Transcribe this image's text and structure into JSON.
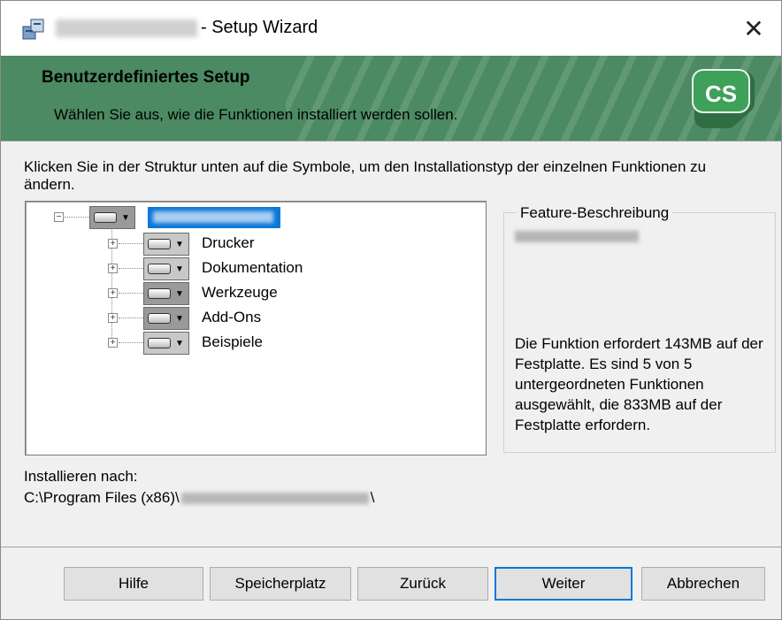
{
  "window": {
    "title": "- Setup Wizard",
    "close_glyph": "✕"
  },
  "banner": {
    "heading": "Benutzerdefiniertes Setup",
    "subtitle": "Wählen Sie aus, wie die Funktionen installiert werden sollen.",
    "logo_text": "CS",
    "logo_color": "#3fa05a",
    "background_color": "#4b8a62"
  },
  "instructions": "Klicken Sie in der Struktur unten auf die Symbole, um den Installationstyp der einzelnen Funktionen zu ändern.",
  "tree": {
    "root": {
      "expander": "−",
      "selected": true
    },
    "items": [
      {
        "label": "Drucker",
        "expander": "+"
      },
      {
        "label": "Dokumentation",
        "expander": "+"
      },
      {
        "label": "Werkzeuge",
        "expander": "+"
      },
      {
        "label": "Add-Ons",
        "expander": "+"
      },
      {
        "label": "Beispiele",
        "expander": "+"
      }
    ]
  },
  "feature": {
    "legend": "Feature-Beschreibung",
    "text": "Die Funktion erfordert 143MB auf der Festplatte. Es sind 5 von 5 untergeordneten Funktionen ausgewählt, die 833MB auf der Festplatte erfordern."
  },
  "install": {
    "label": "Installieren nach:",
    "path_prefix": "C:\\Program Files (x86)\\",
    "path_suffix": "\\"
  },
  "buttons": {
    "help": "Hilfe",
    "disk": "Speicherplatz",
    "back": "Zurück",
    "next": "Weiter",
    "cancel": "Abbrechen"
  }
}
